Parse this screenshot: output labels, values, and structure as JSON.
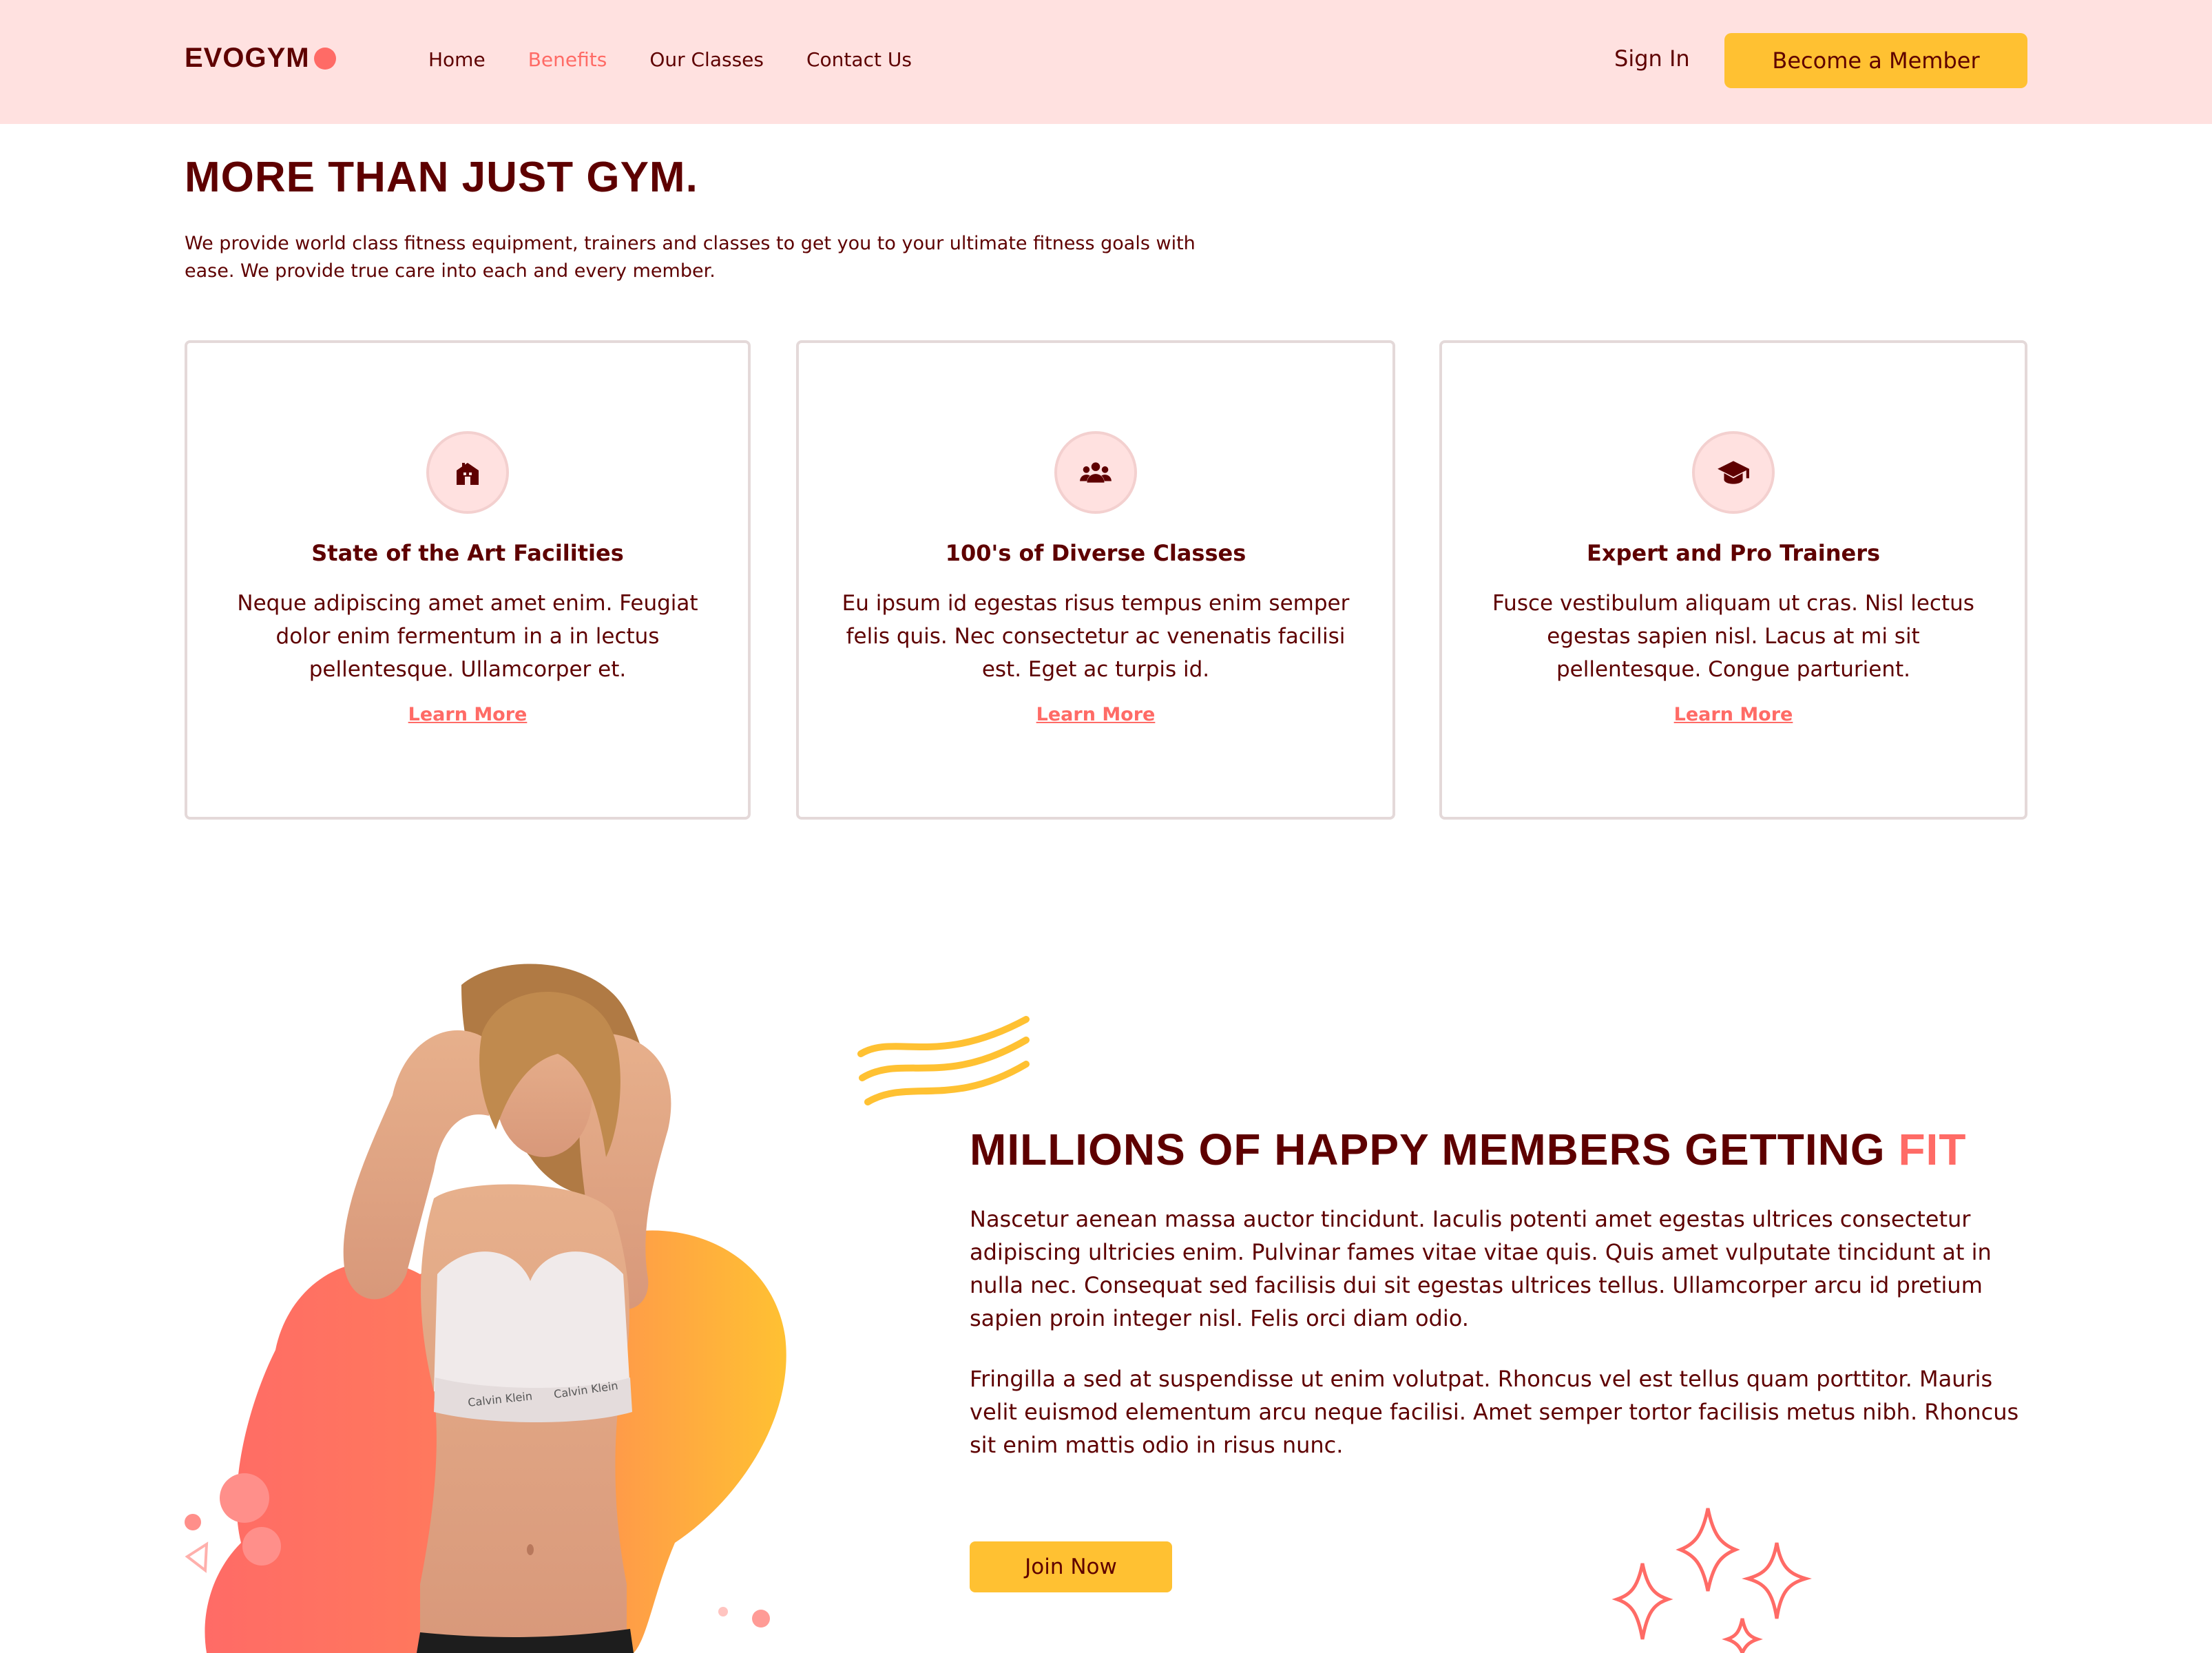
{
  "nav": {
    "logo": "EVOGYM",
    "links": [
      "Home",
      "Benefits",
      "Our Classes",
      "Contact Us"
    ],
    "active_link": "Benefits",
    "sign_in": "Sign In",
    "cta": "Become a Member"
  },
  "benefits": {
    "title": "MORE THAN JUST GYM.",
    "description": "We provide world class fitness equipment, trainers and classes to get you to your ultimate fitness goals with ease. We provide true care into each and every member.",
    "cards": [
      {
        "icon": "home-icon",
        "title": "State of the Art Facilities",
        "text": "Neque adipiscing amet amet enim. Feugiat dolor enim fermentum in a in lectus pellentesque. Ullamcorper et.",
        "link": "Learn More"
      },
      {
        "icon": "user-group-icon",
        "title": "100's of Diverse Classes",
        "text": "Eu ipsum id egestas risus tempus enim semper felis quis. Nec consectetur ac venenatis facilisi est. Eget ac turpis id.",
        "link": "Learn More"
      },
      {
        "icon": "academic-cap-icon",
        "title": "Expert and Pro Trainers",
        "text": "Fusce vestibulum aliquam ut cras. Nisl lectus egestas sapien nisl. Lacus at mi sit pellentesque. Congue parturient.",
        "link": "Learn More"
      }
    ]
  },
  "graphic": {
    "waistband_text": "Calvin Klein"
  },
  "fit": {
    "title": "MILLIONS OF HAPPY MEMBERS GETTING ",
    "title_accent": "FIT",
    "paragraph_1": "Nascetur aenean massa auctor tincidunt. Iaculis potenti amet egestas ultrices consectetur adipiscing ultricies enim. Pulvinar fames vitae vitae quis. Quis amet vulputate tincidunt at in nulla nec. Consequat sed facilisis dui sit egestas ultrices tellus. Ullamcorper arcu id pretium sapien proin integer nisl. Felis orci diam odio.",
    "paragraph_2": "Fringilla a sed at suspendisse ut enim volutpat. Rhoncus vel est tellus quam porttitor. Mauris velit euismod elementum arcu neque facilisi. Amet semper tortor facilisis metus nibh. Rhoncus sit enim mattis odio in risus nunc.",
    "button": "Join Now"
  },
  "colors": {
    "primary_dark": "#5e0000",
    "accent_red": "#ff6b66",
    "accent_yellow": "#ffc132",
    "nav_bg": "#ffe1e0"
  }
}
